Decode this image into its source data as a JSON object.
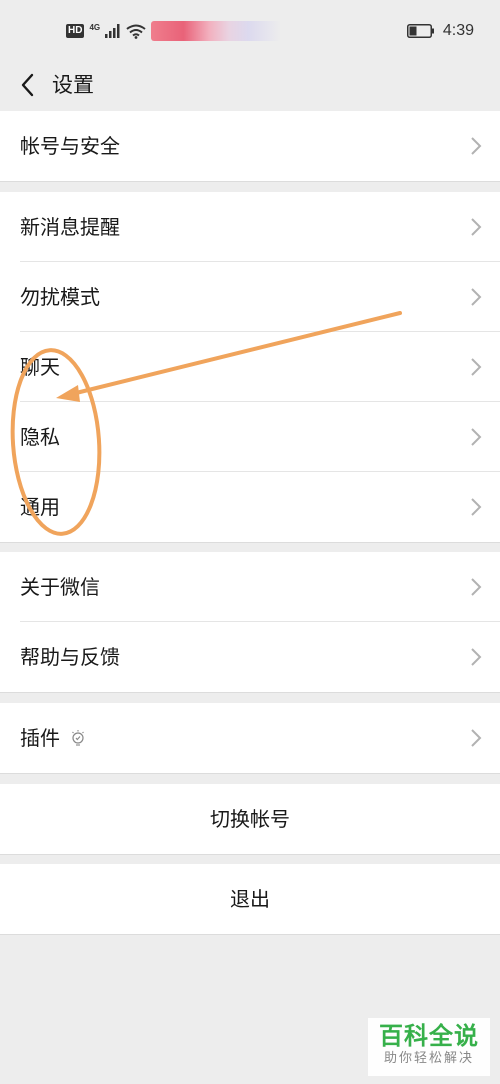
{
  "status_bar": {
    "network_badge": "HD",
    "network_type": "4G",
    "time": "4:39",
    "icons": [
      "hd-icon",
      "signal-icon",
      "wifi-icon",
      "battery-icon"
    ]
  },
  "header": {
    "title": "设置",
    "back_icon": "chevron-left-icon"
  },
  "settings": {
    "group1": {
      "items": [
        {
          "label": "帐号与安全"
        }
      ]
    },
    "group2": {
      "items": [
        {
          "label": "新消息提醒"
        },
        {
          "label": "勿扰模式"
        },
        {
          "label": "聊天"
        },
        {
          "label": "隐私"
        },
        {
          "label": "通用"
        }
      ]
    },
    "group3": {
      "items": [
        {
          "label": "关于微信"
        },
        {
          "label": "帮助与反馈"
        }
      ]
    },
    "group4": {
      "items": [
        {
          "label": "插件",
          "icon": "lightbulb-icon"
        }
      ]
    }
  },
  "actions": {
    "switch_account": "切换帐号",
    "logout": "退出"
  },
  "watermark": {
    "title": "百科全说",
    "subtitle": "助你轻松解决"
  },
  "colors": {
    "background": "#ededed",
    "card": "#ffffff",
    "annotation": "#f0a45c",
    "watermark_green": "#36b04a"
  }
}
